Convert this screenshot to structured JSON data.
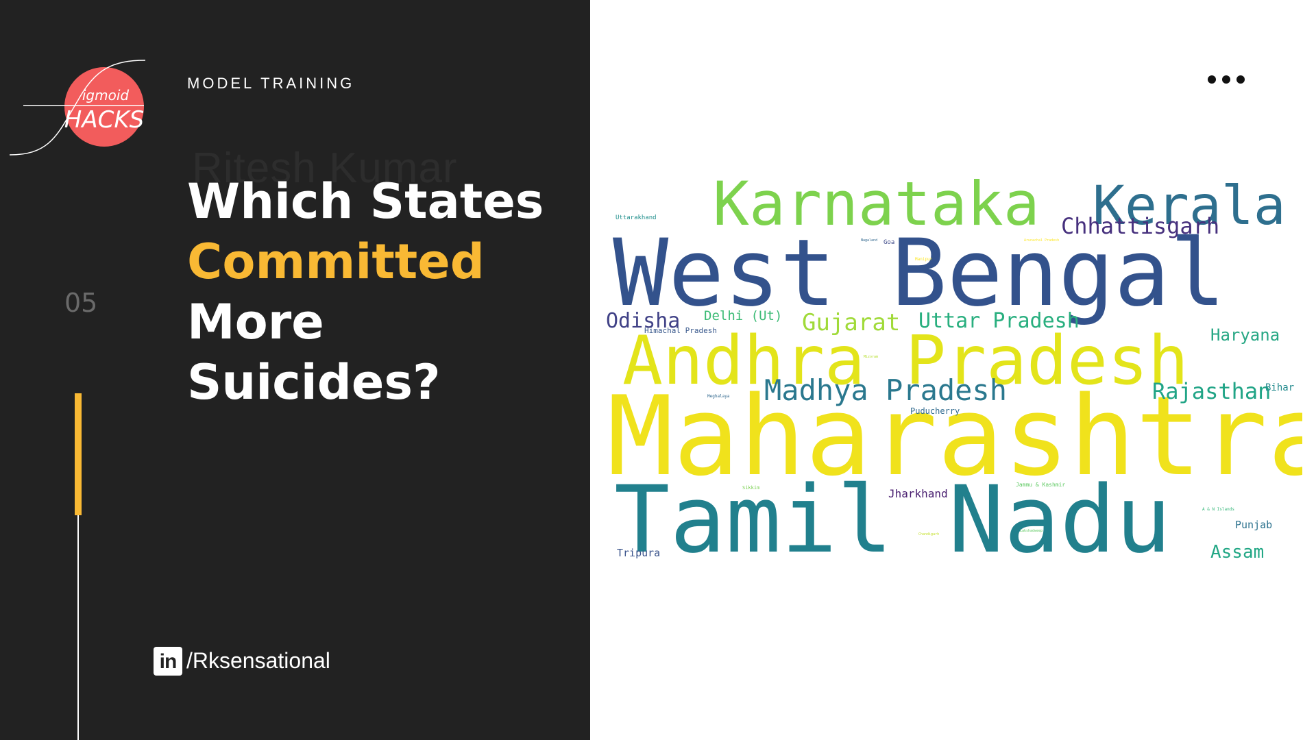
{
  "sidebar": {
    "logo_text_top": "igmoid",
    "logo_text_bottom": "HACKS",
    "section_label": "MODEL TRAINING",
    "ghost_text": "Ritesh Kumar",
    "title_lines": [
      "Which States",
      "Committed",
      "More",
      "Suicides?"
    ],
    "slide_number": "05",
    "linkedin_icon_text": "in",
    "linkedin_handle": "/Rksensational"
  },
  "colors": {
    "panel_background": "#222222",
    "accent": "#f9b934",
    "logo_red": "#f25c5c",
    "text_white": "#ffffff"
  },
  "icons": {
    "more_menu": "more-horizontal-icon",
    "linkedin": "linkedin-icon"
  },
  "wordcloud": {
    "words": [
      {
        "text": "Maharashtra",
        "color": "#f0e21c"
      },
      {
        "text": "Tamil Nadu",
        "color": "#21808d"
      },
      {
        "text": "West Bengal",
        "color": "#33528c"
      },
      {
        "text": "Andhra Pradesh",
        "color": "#e3e41a"
      },
      {
        "text": "Karnataka",
        "color": "#7dd24d"
      },
      {
        "text": "Kerala",
        "color": "#2e6f8e"
      },
      {
        "text": "Madhya Pradesh",
        "color": "#2a788e"
      },
      {
        "text": "Chhattisgarh",
        "color": "#46307d"
      },
      {
        "text": "Gujarat",
        "color": "#a0da39"
      },
      {
        "text": "Uttar Pradesh",
        "color": "#29af7f"
      },
      {
        "text": "Odisha",
        "color": "#414287"
      },
      {
        "text": "Rajasthan",
        "color": "#20a486"
      },
      {
        "text": "Haryana",
        "color": "#26a784"
      },
      {
        "text": "Assam",
        "color": "#22a785"
      },
      {
        "text": "Delhi (Ut)",
        "color": "#3bbb75"
      },
      {
        "text": "Jharkhand",
        "color": "#481d6f"
      },
      {
        "text": "Punjab",
        "color": "#2c728e"
      },
      {
        "text": "Tripura",
        "color": "#3a538b"
      },
      {
        "text": "Bihar",
        "color": "#238a8d"
      },
      {
        "text": "Puducherry",
        "color": "#306a8e"
      },
      {
        "text": "Himachal Pradesh",
        "color": "#38588c"
      },
      {
        "text": "Uttarakhand",
        "color": "#22908d"
      },
      {
        "text": "Goa",
        "color": "#3e4a89"
      },
      {
        "text": "Jammu & Kashmir",
        "color": "#5ec962"
      },
      {
        "text": "A & N Islands",
        "color": "#35b779"
      },
      {
        "text": "Sikkim",
        "color": "#7ad151"
      },
      {
        "text": "Meghalaya",
        "color": "#31688e"
      },
      {
        "text": "Nagaland",
        "color": "#31688e"
      },
      {
        "text": "Arunachal Pradesh",
        "color": "#fde725"
      },
      {
        "text": "Manipur",
        "color": "#fde725"
      },
      {
        "text": "Mizoram",
        "color": "#b5de2b"
      },
      {
        "text": "Chandigarh",
        "color": "#c2df23"
      },
      {
        "text": "Lakshadweep",
        "color": "#5ec962"
      }
    ]
  }
}
